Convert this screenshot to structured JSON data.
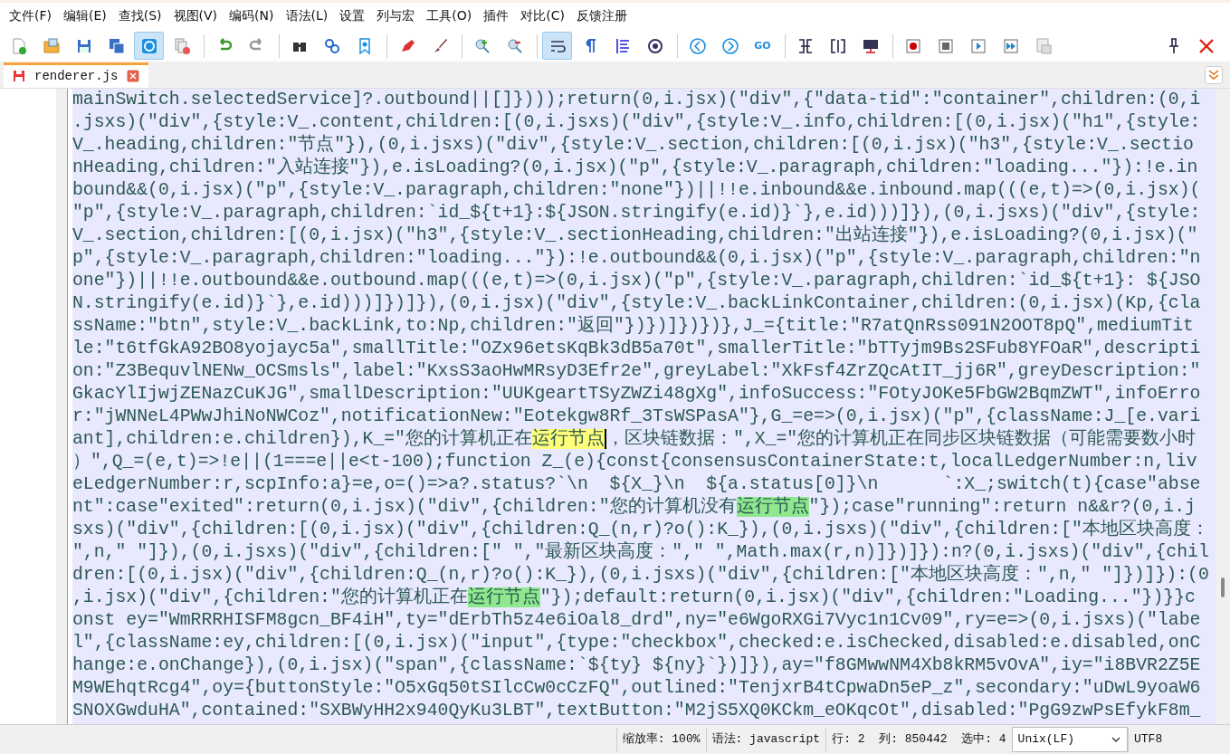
{
  "menu": [
    "文件(F)",
    "编辑(E)",
    "查找(S)",
    "视图(V)",
    "编码(N)",
    "语法(L)",
    "设置",
    "列与宏",
    "工具(O)",
    "插件",
    "对比(C)",
    "反馈注册"
  ],
  "toolbar": [
    {
      "kind": "new-file",
      "pressed": false
    },
    {
      "kind": "open",
      "pressed": false
    },
    {
      "kind": "save",
      "pressed": false
    },
    {
      "kind": "save-all",
      "pressed": false
    },
    {
      "kind": "sync",
      "pressed": true
    },
    {
      "kind": "close-all",
      "pressed": false
    },
    {
      "kind": "separator"
    },
    {
      "kind": "undo",
      "pressed": false
    },
    {
      "kind": "redo",
      "pressed": false
    },
    {
      "kind": "separator"
    },
    {
      "kind": "find",
      "pressed": false
    },
    {
      "kind": "replace",
      "pressed": false
    },
    {
      "kind": "bookmark",
      "pressed": false
    },
    {
      "kind": "separator"
    },
    {
      "kind": "marker",
      "pressed": false
    },
    {
      "kind": "brush",
      "pressed": false
    },
    {
      "kind": "separator"
    },
    {
      "kind": "zoom-in",
      "pressed": false
    },
    {
      "kind": "zoom-out",
      "pressed": false
    },
    {
      "kind": "separator"
    },
    {
      "kind": "word-wrap",
      "pressed": true
    },
    {
      "kind": "paragraph",
      "pressed": false
    },
    {
      "kind": "indent-guide",
      "pressed": false
    },
    {
      "kind": "target",
      "pressed": false
    },
    {
      "kind": "separator"
    },
    {
      "kind": "previous",
      "pressed": false
    },
    {
      "kind": "next",
      "pressed": false
    },
    {
      "kind": "go",
      "pressed": false,
      "text": "GO"
    },
    {
      "kind": "separator"
    },
    {
      "kind": "split-view",
      "pressed": false
    },
    {
      "kind": "column-view",
      "pressed": false
    },
    {
      "kind": "monitor",
      "pressed": false
    },
    {
      "kind": "separator"
    },
    {
      "kind": "record",
      "pressed": false
    },
    {
      "kind": "stop",
      "pressed": false
    },
    {
      "kind": "play",
      "pressed": false
    },
    {
      "kind": "fast-forward",
      "pressed": false
    },
    {
      "kind": "save-macro",
      "pressed": false
    }
  ],
  "tab": {
    "label": "renderer.js"
  },
  "code_lines": [
    {
      "text": "mainSwitch.selectedService]?.outbound||[]})));return(0,i.jsx)(\"div\",{\"data-tid\":\"container\",children:(0,i"
    },
    {
      "text": ".jsxs)(\"div\",{style:V_.content,children:[(0,i.jsxs)(\"div\",{style:V_.info,children:[(0,i.jsx)(\"h1\",{style:"
    },
    {
      "text": "V_.heading,children:\"节点\"}),(0,i.jsxs)(\"div\",{style:V_.section,children:[(0,i.jsx)(\"h3\",{style:V_.sectio"
    },
    {
      "text": "nHeading,children:\"入站连接\"}),e.isLoading?(0,i.jsx)(\"p\",{style:V_.paragraph,children:\"loading...\"}):!e.in"
    },
    {
      "text": "bound&&(0,i.jsx)(\"p\",{style:V_.paragraph,children:\"none\"})||!!e.inbound&&e.inbound.map(((e,t)=>(0,i.jsx)("
    },
    {
      "text": "\"p\",{style:V_.paragraph,children:`id_${t+1}:${JSON.stringify(e.id)}`},e.id)))]}),(0,i.jsxs)(\"div\",{style:"
    },
    {
      "text": "V_.section,children:[(0,i.jsx)(\"h3\",{style:V_.sectionHeading,children:\"出站连接\"}),e.isLoading?(0,i.jsx)(\""
    },
    {
      "text": "p\",{style:V_.paragraph,children:\"loading...\"}):!e.outbound&&(0,i.jsx)(\"p\",{style:V_.paragraph,children:\"n"
    },
    {
      "text": "one\"})||!!e.outbound&&e.outbound.map(((e,t)=>(0,i.jsx)(\"p\",{style:V_.paragraph,children:`id_${t+1}: ${JSO"
    },
    {
      "text": "N.stringify(e.id)}`},e.id)))]})]}),(0,i.jsx)(\"div\",{style:V_.backLinkContainer,children:(0,i.jsx)(Kp,{cla"
    },
    {
      "text": "ssName:\"btn\",style:V_.backLink,to:Np,children:\"返回\"})})]})})},J_={title:\"R7atQnRss091N2OOT8pQ\",mediumTit"
    },
    {
      "text": "le:\"t6tfGkA92BO8yojayc5a\",smallTitle:\"OZx96etsKqBk3dB5a70t\",smallerTitle:\"bTTyjm9Bs2SFub8YFOaR\",descripti"
    },
    {
      "text": "on:\"Z3BequvlNENw_OCSmsls\",label:\"KxsS3aoHwMRsyD3Efr2e\",greyLabel:\"XkFsf4ZrZQcAtIT_jj6R\",greyDescription:\""
    },
    {
      "text": "GkacYlIjwjZENazCuKJG\",smallDescription:\"UUKgeartTSyZWZi48gXg\",infoSuccess:\"FOtyJOKe5FbGW2BqmZWT\",infoErro"
    },
    {
      "text": "r:\"jWNNeL4PWwJhiNoNWCoz\",notificationNew:\"Eotekgw8Rf_3TsWSPasA\"},G_=e=>(0,i.jsx)(\"p\",{className:J_[e.vari"
    },
    {
      "text": "ant],children:e.children}),K_=\"您的计算机正在",
      "mark": {
        "text": "运行节点",
        "kind": "selection"
      },
      "rest": "，区块链数据：\",X_=\"您的计算机正在同步区块链数据（可能需要数小时"
    },
    {
      "text": "）\",Q_=(e,t)=>!e||(1===e||e<t-100);function Z_(e){const{consensusContainerState:t,localLedgerNumber:n,liv"
    },
    {
      "text": "eLedgerNumber:r,scpInfo:a}=e,o=()=>a?.status?`\\n  ${X_}\\n  ${a.status[0]}\\n      `:X_;switch(t){case\"abse"
    },
    {
      "text": "nt\":case\"exited\":return(0,i.jsx)(\"div\",{children:\"您的计算机没有",
      "mark": {
        "text": "运行节点",
        "kind": "match"
      },
      "rest": "\"});case\"running\":return n&&r?(0,i.j"
    },
    {
      "text": "sxs)(\"div\",{children:[(0,i.jsx)(\"div\",{children:Q_(n,r)?o():K_}),(0,i.jsxs)(\"div\",{children:[\"本地区块高度："
    },
    {
      "text": "\",n,\" \"]}),(0,i.jsxs)(\"div\",{children:[\" \",\"最新区块高度：\",\" \",Math.max(r,n)]})]}):n?(0,i.jsxs)(\"div\",{chil"
    },
    {
      "text": "dren:[(0,i.jsx)(\"div\",{children:Q_(n,r)?o():K_}),(0,i.jsxs)(\"div\",{children:[\"本地区块高度：\",n,\" \"]})]}):(0"
    },
    {
      "text": ",i.jsx)(\"div\",{children:\"您的计算机正在",
      "mark": {
        "text": "运行节点",
        "kind": "match"
      },
      "rest": "\"});default:return(0,i.jsx)(\"div\",{children:\"Loading...\"})}}c"
    },
    {
      "text": "onst ey=\"WmRRRHISFM8gcn_BF4iH\",ty=\"dErbTh5z4e6iOal8_drd\",ny=\"e6WgoRXGi7Vyc1n1Cv09\",ry=e=>(0,i.jsxs)(\"labe"
    },
    {
      "text": "l\",{className:ey,children:[(0,i.jsx)(\"input\",{type:\"checkbox\",checked:e.isChecked,disabled:e.disabled,onC"
    },
    {
      "text": "hange:e.onChange}),(0,i.jsx)(\"span\",{className:`${ty} ${ny}`})]}),ay=\"f8GMwwNM4Xb8kRM5vOvA\",iy=\"i8BVR2Z5E"
    },
    {
      "text": "M9WEhqtRcg4\",oy={buttonStyle:\"O5xGq50tSIlcCw0cCzFQ\",outlined:\"TenjxrB4tCpwaDn5eP_z\",secondary:\"uDwL9yoaW6"
    },
    {
      "text": "SNOXGwduHA\",contained:\"SXBWyHH2x940QyKu3LBT\",textButton:\"M2jS5XQ0KCkm_eOKqcOt\",disabled:\"PgG9zwPsEfykF8m_"
    }
  ],
  "status_bar": {
    "zoom": "缩放率: 100%",
    "language": "语法: javascript",
    "position": "行: 2  列: 850442  选中: 4",
    "eol": "Unix(LF)",
    "encoding": "UTF8"
  }
}
